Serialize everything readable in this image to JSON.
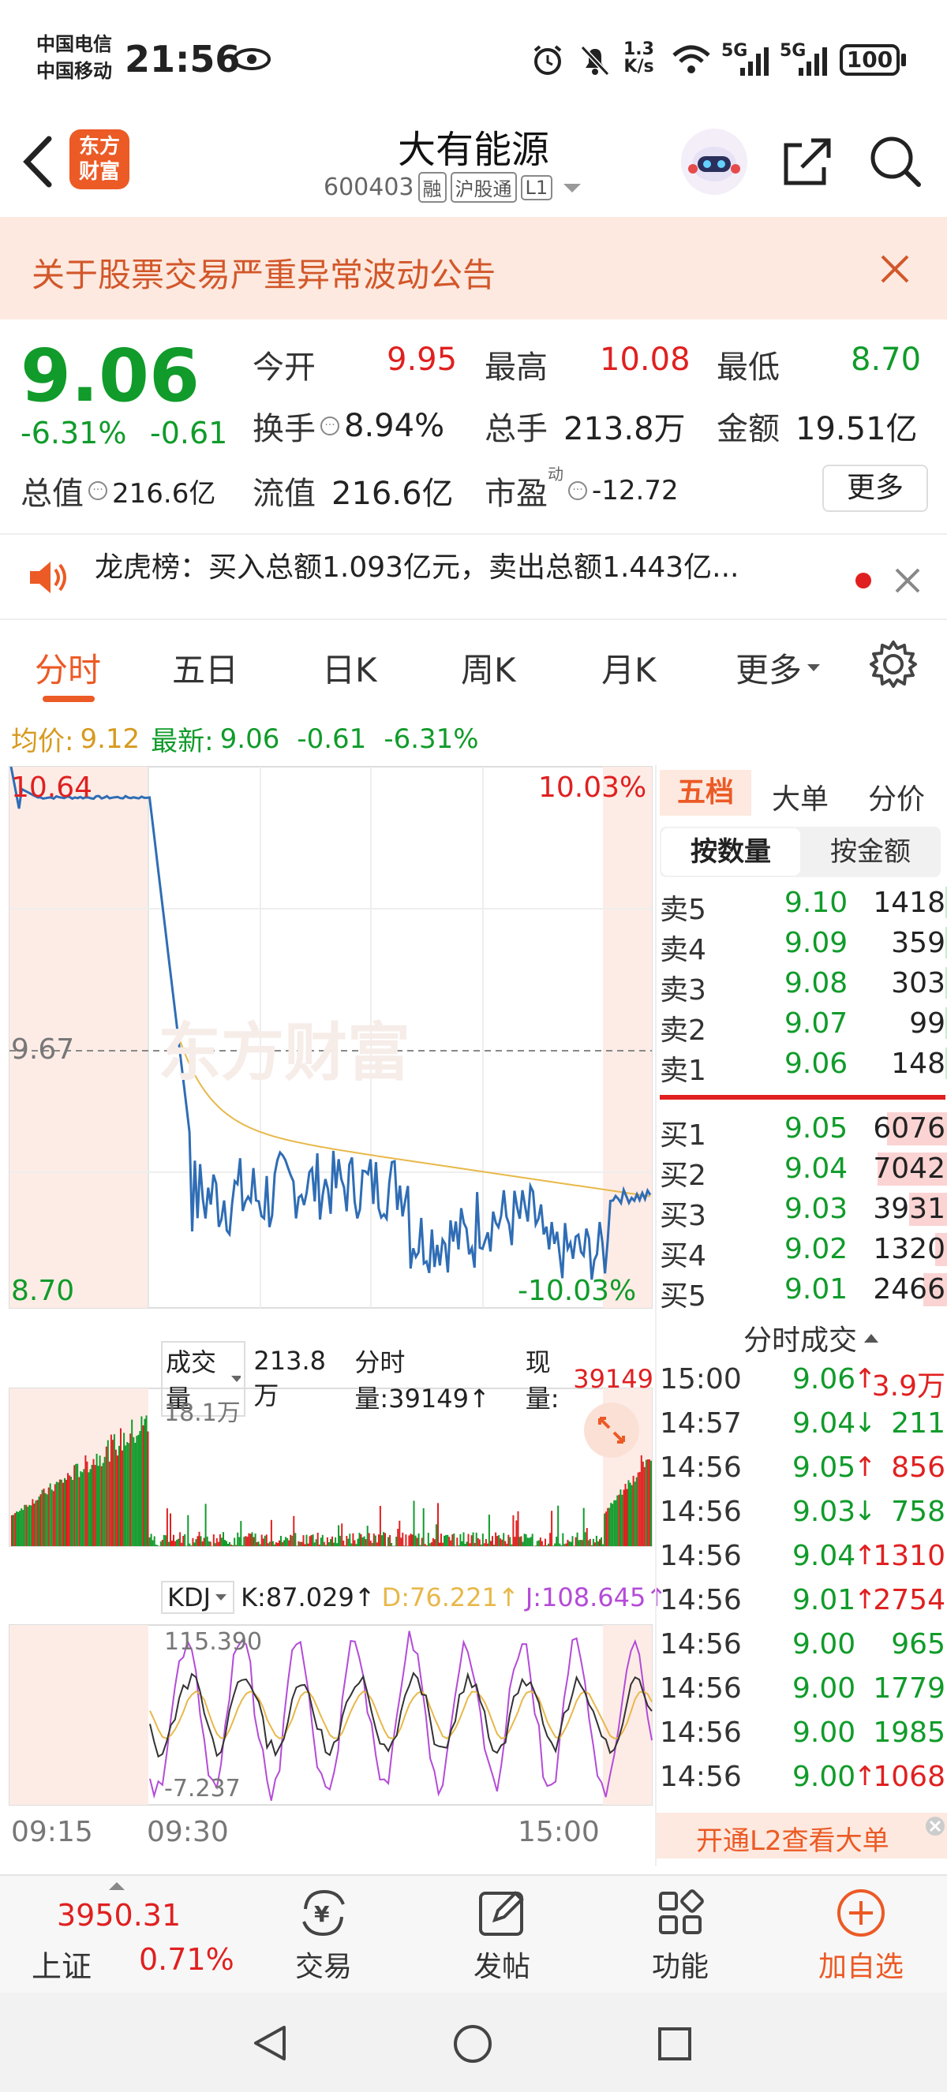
{
  "status_bar": {
    "carrier_1": "中国电信",
    "carrier_2": "中国移动",
    "time": "21:56",
    "net_speed_value": "1.3",
    "net_speed_unit": "K/s",
    "signal_1": "5G",
    "signal_2": "5G",
    "battery": "100"
  },
  "header": {
    "logo_line1": "东方",
    "logo_line2": "财富",
    "stock_name": "大有能源",
    "stock_code": "600403",
    "tags": [
      "融",
      "沪股通",
      "L1"
    ]
  },
  "notice": {
    "text": "关于股票交易严重异常波动公告"
  },
  "quote": {
    "price": "9.06",
    "change_pct": "-6.31%",
    "change": "-0.61",
    "open_label": "今开",
    "open": "9.95",
    "high_label": "最高",
    "high": "10.08",
    "low_label": "最低",
    "low": "8.70",
    "turnover_label": "换手",
    "turnover": "8.94%",
    "volume_label": "总手",
    "volume": "213.8万",
    "amount_label": "金额",
    "amount": "19.51亿",
    "mktcap_label": "总值",
    "mktcap": "216.6亿",
    "float_label": "流值",
    "float_value": "216.6亿",
    "pe_label": "市盈",
    "pe_sup": "动",
    "pe": "-12.72",
    "more": "更多"
  },
  "dragon_tiger": {
    "text": "龙虎榜：买入总额1.093亿元，卖出总额1.443亿..."
  },
  "tabs": [
    "分时",
    "五日",
    "日K",
    "周K",
    "月K",
    "更多"
  ],
  "intraday": {
    "avg_label": "均价:",
    "avg": "9.12",
    "latest_label": "最新:",
    "latest": "9.06",
    "latest_change": "-0.61",
    "latest_pct": "-6.31%",
    "y_high": "10.64",
    "y_mid": "9.67",
    "y_low": "8.70",
    "pct_high": "10.03%",
    "pct_low": "-10.03%",
    "watermark": "东方财富",
    "vol_label": "成交量",
    "vol_total": "213.8万",
    "vol_tick_label": "分时量:39149↑",
    "vol_now_label": "现量:",
    "vol_now": "39149",
    "vol_max": "18.1万",
    "kdj_label": "KDJ",
    "k": "K:87.029↑",
    "d": "D:76.221↑",
    "j": "J:108.645↑",
    "kdj_max": "115.390",
    "kdj_min": "-7.237",
    "times": [
      "09:15",
      "09:30",
      "15:00"
    ],
    "colors": {
      "price": "#2f6db5",
      "avg": "#e8b84a",
      "up": "#e02020",
      "down": "#109b2a",
      "k": "#333333",
      "d": "#e8b84a",
      "j": "#b44bd8"
    }
  },
  "order_book": {
    "tabs": [
      "五档",
      "大单",
      "分价"
    ],
    "subtabs": [
      "按数量",
      "按金额"
    ],
    "asks": [
      {
        "label": "卖5",
        "price": "9.10",
        "qty": "1418"
      },
      {
        "label": "卖4",
        "price": "9.09",
        "qty": "359"
      },
      {
        "label": "卖3",
        "price": "9.08",
        "qty": "303"
      },
      {
        "label": "卖2",
        "price": "9.07",
        "qty": "99"
      },
      {
        "label": "卖1",
        "price": "9.06",
        "qty": "148"
      }
    ],
    "bids": [
      {
        "label": "买1",
        "price": "9.05",
        "qty": "6076",
        "level": 0.78
      },
      {
        "label": "买2",
        "price": "9.04",
        "qty": "7042",
        "level": 0.9
      },
      {
        "label": "买3",
        "price": "9.03",
        "qty": "3931",
        "level": 0.5
      },
      {
        "label": "买4",
        "price": "9.02",
        "qty": "1320",
        "level": 0.17
      },
      {
        "label": "买5",
        "price": "9.01",
        "qty": "2466",
        "level": 0.32
      }
    ],
    "ticks_title": "分时成交",
    "ticks": [
      {
        "time": "15:00",
        "price": "9.06",
        "arrow": "↑",
        "qty": "3.9万",
        "dir": "up"
      },
      {
        "time": "14:57",
        "price": "9.04",
        "arrow": "↓",
        "qty": "211",
        "dir": "down"
      },
      {
        "time": "14:56",
        "price": "9.05",
        "arrow": "↑",
        "qty": "856",
        "dir": "up"
      },
      {
        "time": "14:56",
        "price": "9.03",
        "arrow": "↓",
        "qty": "758",
        "dir": "down"
      },
      {
        "time": "14:56",
        "price": "9.04",
        "arrow": "↑",
        "qty": "1310",
        "dir": "up"
      },
      {
        "time": "14:56",
        "price": "9.01",
        "arrow": "↑",
        "qty": "2754",
        "dir": "up"
      },
      {
        "time": "14:56",
        "price": "9.00",
        "arrow": "",
        "qty": "965",
        "dir": "none"
      },
      {
        "time": "14:56",
        "price": "9.00",
        "arrow": "",
        "qty": "1779",
        "dir": "none"
      },
      {
        "time": "14:56",
        "price": "9.00",
        "arrow": "",
        "qty": "1985",
        "dir": "none"
      },
      {
        "time": "14:56",
        "price": "9.00",
        "arrow": "↑",
        "qty": "1068",
        "dir": "up"
      }
    ],
    "l2_promo": "开通L2查看大单"
  },
  "bottom_nav": {
    "index_value": "3950.31",
    "index_name": "上证",
    "index_pct": "0.71%",
    "items": [
      "交易",
      "发帖",
      "功能",
      "加自选"
    ]
  }
}
